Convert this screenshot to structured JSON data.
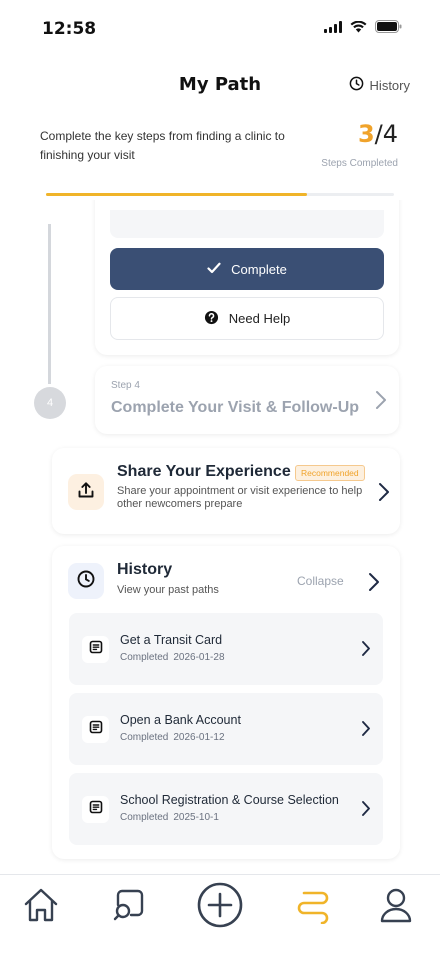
{
  "status_bar": {
    "time": "12:58"
  },
  "header": {
    "title": "My Path",
    "history_label": "History"
  },
  "progress": {
    "description": "Complete the key steps from finding a clinic to finishing your visit",
    "completed": "3",
    "total": "/4",
    "caption": "Steps Completed",
    "fraction": 0.75
  },
  "current_step": {
    "complete_label": "Complete",
    "help_label": "Need Help"
  },
  "next_step": {
    "number": "4",
    "label": "Step 4",
    "title": "Complete Your Visit & Follow-Up"
  },
  "share": {
    "title": "Share Your Experience",
    "badge": "Recommended",
    "description": "Share your appointment or visit experience to help other newcomers prepare"
  },
  "history": {
    "title": "History",
    "subtitle": "View your past paths",
    "collapse_label": "Collapse",
    "items": [
      {
        "title": "Get a Transit Card",
        "status": "Completed",
        "date": "2026-01-28"
      },
      {
        "title": "Open a Bank Account",
        "status": "Completed",
        "date": "2026-01-12"
      },
      {
        "title": "School Registration & Course Selection",
        "status": "Completed",
        "date": "2025-10-1"
      }
    ]
  },
  "tab_bar": {
    "tabs": [
      "home-icon",
      "search-chat-icon",
      "add-circle-icon",
      "path-icon",
      "profile-icon"
    ],
    "active_tab": "path-icon",
    "active_color": "#f0b429",
    "inactive_color": "#374151"
  },
  "colors": {
    "accent": "#f0a32b",
    "primary_button": "#3a4f74"
  }
}
